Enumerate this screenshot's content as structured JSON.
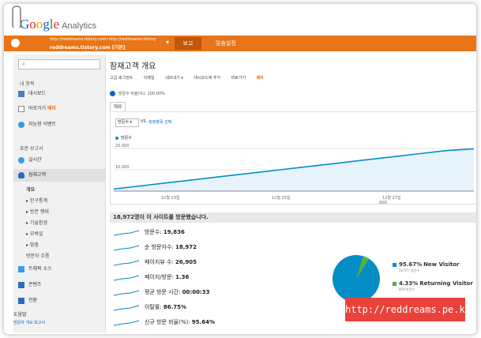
{
  "logo": {
    "google_parts": [
      "G",
      "o",
      "o",
      "g",
      "l",
      "e"
    ],
    "analytics": "Analytics"
  },
  "topbar": {
    "account_url": "http://reddreams.tistory.com/-http://reddreams.tistory",
    "account_name": "reddreams.tistory.com [기본]",
    "caret": "▾",
    "tab_report": "보고",
    "tab_custom": "맞춤설정"
  },
  "sidebar": {
    "my_report_heading": "내 항목",
    "dashboard": "대시보드",
    "shortcuts": "바로가기",
    "beta": "베타",
    "intelligence": "지능형 이벤트",
    "standard_reports": "표준 보고서",
    "realtime": "실시간",
    "audience": "잠재고객",
    "overview": "개요",
    "demographics": "▸ 인구통계",
    "behavior": "▸ 방문 행태",
    "technology": "▸ 기술환경",
    "mobile": "▸ 모바일",
    "custom": "▸ 맞춤",
    "visitor_flow": "방문자 흐름",
    "traffic_sources": "트래픽 소스",
    "content": "콘텐츠",
    "conversions": "전환",
    "help": "도움말",
    "help_link": "방문자 개요 보고서"
  },
  "main": {
    "title": "잠재고객 개요",
    "toolbar": [
      "고급 세그먼트",
      "이메일",
      "내보내기 ▾",
      "대시보드에 추가",
      "바로가기"
    ],
    "toolbar_beta": "베타",
    "segment_text": "방문수 비율(%): 100.00%",
    "tab_overview": "개요",
    "metric_select": "방문수 ▾",
    "vs": "VS.",
    "select_metric": "측정항목 선택",
    "legend": "방문수",
    "summary": "18,972명이 이 사이트를 방문했습니다.",
    "stats": [
      {
        "label": "방문수: ",
        "value": "19,836"
      },
      {
        "label": "순 방문자수: ",
        "value": "18,972"
      },
      {
        "label": "페이지뷰 수: ",
        "value": "26,905"
      },
      {
        "label": "페이지/방문: ",
        "value": "1.36"
      },
      {
        "label": "평균 방문 시간: ",
        "value": "00:00:33"
      },
      {
        "label": "이탈률: ",
        "value": "86.75%"
      },
      {
        "label": "신규 방문 비율(%): ",
        "value": "95.64%"
      }
    ],
    "pie": {
      "new_pct": "95.67%",
      "new_label": "New Visitor",
      "new_sub": "18,977 방문수",
      "ret_pct": "4.33%",
      "ret_label": "Returning Visitor",
      "ret_sub": "859 방문수"
    }
  },
  "chart_data": {
    "type": "area",
    "y_tick_labels": [
      "20,000",
      "10,000"
    ],
    "ylim": [
      0,
      20000
    ],
    "x_tick_labels": [
      "12월 23일",
      "12월 25일",
      "12월 27일"
    ],
    "series": [
      {
        "name": "방문수",
        "values": [
          1000,
          2500,
          4000,
          5500,
          7000,
          8500,
          10000,
          11500,
          13000,
          14500,
          16000,
          17500,
          19000,
          19836
        ]
      }
    ]
  },
  "watermark": "http://reddreams.pe.kr",
  "colors": {
    "accent": "#e8751a",
    "line": "#058dc7",
    "fill": "#e6f3fb",
    "new_visitor": "#058dc7",
    "returning": "#50b432",
    "watermark": "#e9423b"
  }
}
